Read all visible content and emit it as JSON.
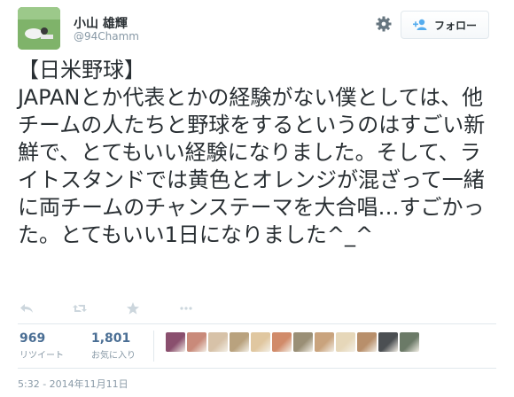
{
  "user": {
    "name": "小山 雄輝",
    "handle": "@94Chamm"
  },
  "follow_button": {
    "label": "フォロー"
  },
  "tweet": {
    "text": "【日米野球】\nJAPANとか代表とかの経験がない僕としては、他チームの人たちと野球をするというのはすごい新鮮で、とてもいい経験になりました。そして、ライトスタンドでは黄色とオレンジが混ざって一緒に両チームのチャンステーマを大合唱…すごかった。とてもいい1日になりました^_^"
  },
  "actions": {
    "icons": [
      "reply-icon",
      "retweet-icon",
      "favorite-icon",
      "more-icon"
    ]
  },
  "stats": {
    "retweets": {
      "count": "969",
      "label": "リツイート"
    },
    "favorites": {
      "count": "1,801",
      "label": "お気に入り"
    }
  },
  "favorited_by": [
    {
      "color": "#8a4f6e"
    },
    {
      "color": "#c98a7a"
    },
    {
      "color": "#d7c2a8"
    },
    {
      "color": "#b9a27e"
    },
    {
      "color": "#e0c7a0"
    },
    {
      "color": "#d18b6a"
    },
    {
      "color": "#9a8f76"
    },
    {
      "color": "#c9a37d"
    },
    {
      "color": "#e6d7b9"
    },
    {
      "color": "#b88f6b"
    },
    {
      "color": "#4b4f52"
    },
    {
      "color": "#6b7a67"
    }
  ],
  "timestamp": "5:32 - 2014年11月11日",
  "colors": {
    "text": "#292f33",
    "muted": "#8899a6",
    "stat_number": "#4a6e94",
    "border": "#e1e8ed",
    "icon": "#ccd6dd",
    "follow_icon": "#55acee"
  }
}
